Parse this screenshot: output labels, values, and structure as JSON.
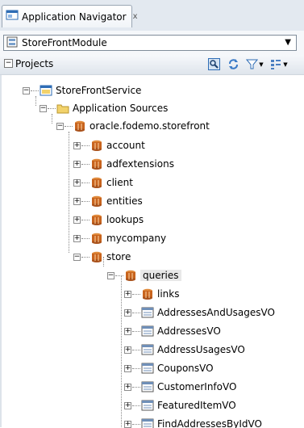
{
  "tab": {
    "title": "Application Navigator",
    "close": "x"
  },
  "module": {
    "selected": "StoreFrontModule"
  },
  "projects": {
    "label": "Projects",
    "collapse": "−"
  },
  "tree": {
    "root": "StoreFrontService",
    "sources": "Application Sources",
    "package": "oracle.fodemo.storefront",
    "pkgs": [
      "account",
      "adfextensions",
      "client",
      "entities",
      "lookups",
      "mycompany",
      "store"
    ],
    "queries": "queries",
    "links": "links",
    "vos": [
      "AddressesAndUsagesVO",
      "AddressesVO",
      "AddressUsagesVO",
      "CouponsVO",
      "CustomerInfoVO",
      "FeaturedItemVO",
      "FindAddressesByIdVO"
    ]
  },
  "colors": {
    "package": "#c8641e",
    "folder": "#f2d26b",
    "accent": "#2f6db5"
  }
}
